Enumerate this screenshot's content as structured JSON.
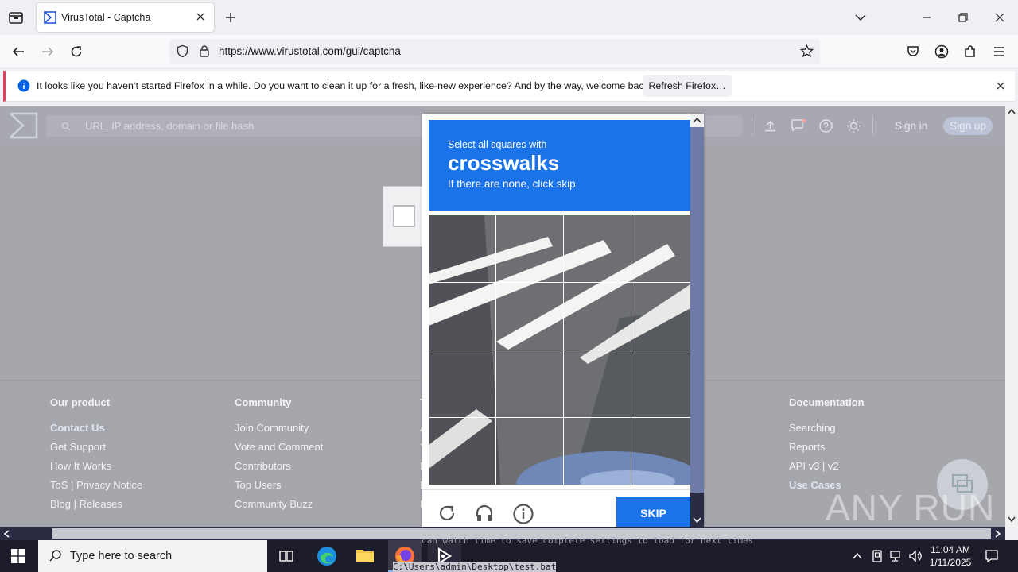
{
  "browser": {
    "tab_title": "VirusTotal - Captcha",
    "url": "https://www.virustotal.com/gui/captcha",
    "notification": {
      "text": "It looks like you haven’t started Firefox in a while. Do you want to clean it up for a fresh, like-new experience? And by the way, welcome back!",
      "button": "Refresh Firefox…"
    }
  },
  "vt": {
    "search_placeholder": "URL, IP address, domain or file hash",
    "sign_in": "Sign in",
    "sign_up": "Sign up",
    "footer": {
      "col1": {
        "heading": "Our product",
        "links": [
          "Contact Us",
          "Get Support",
          "How It Works",
          "ToS | Privacy Notice",
          "Blog | Releases"
        ]
      },
      "col2": {
        "heading": "Community",
        "links": [
          "Join Community",
          "Vote and Comment",
          "Contributors",
          "Top Users",
          "Community Buzz"
        ]
      },
      "col3": {
        "heading": "T",
        "links": [
          "A",
          "Y",
          "D",
          "E",
          "N"
        ]
      },
      "col4": {
        "heading": "Documentation",
        "links": [
          "Searching",
          "Reports",
          "API v3 | v2",
          "Use Cases"
        ]
      }
    }
  },
  "captcha": {
    "prompt_small": "Select all squares with",
    "prompt_target": "crosswalks",
    "prompt_sub": "If there are none, click skip",
    "skip_label": "SKIP"
  },
  "watermark": "ANY RUN",
  "console_text": "can watch time to save complete settings to load for next times",
  "console_path": "C:\\Users\\admin\\Desktop\\test.bat",
  "taskbar": {
    "search_placeholder": "Type here to search",
    "time": "11:04 AM",
    "date": "1/11/2025"
  },
  "colors": {
    "captcha_blue": "#1a73e8",
    "notif_accent": "#e04060"
  }
}
